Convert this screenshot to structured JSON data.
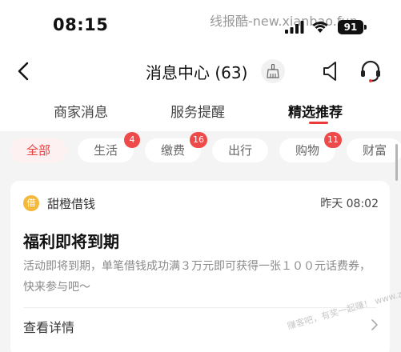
{
  "status_bar": {
    "time": "08:15",
    "watermark": "线报酷-new.xianbao.fun",
    "battery": "91"
  },
  "nav": {
    "title": "消息中心 (63)"
  },
  "tabs": [
    {
      "label": "商家消息",
      "active": false
    },
    {
      "label": "服务提醒",
      "active": false
    },
    {
      "label": "精选推荐",
      "active": true
    }
  ],
  "filters": [
    {
      "label": "全部",
      "active": true,
      "badge": ""
    },
    {
      "label": "生活",
      "active": false,
      "badge": "4"
    },
    {
      "label": "缴费",
      "active": false,
      "badge": "16"
    },
    {
      "label": "出行",
      "active": false,
      "badge": ""
    },
    {
      "label": "购物",
      "active": false,
      "badge": "11"
    },
    {
      "label": "财富",
      "active": false,
      "badge": ""
    }
  ],
  "message": {
    "sender_logo": "借",
    "sender": "甜橙借钱",
    "time": "昨天 08:02",
    "title": "福利即将到期",
    "body": "活动即将到期，单笔借钱成功满３万元即可获得一张１００元话费券，快来参与吧～",
    "detail_label": "查看详情",
    "watermark": "赚客吧，有奖一起赚！ www.zuanke8.com"
  },
  "colors": {
    "accent": "#e93f3f",
    "badge": "#ef4a4a",
    "logo": "#f4b93b"
  }
}
